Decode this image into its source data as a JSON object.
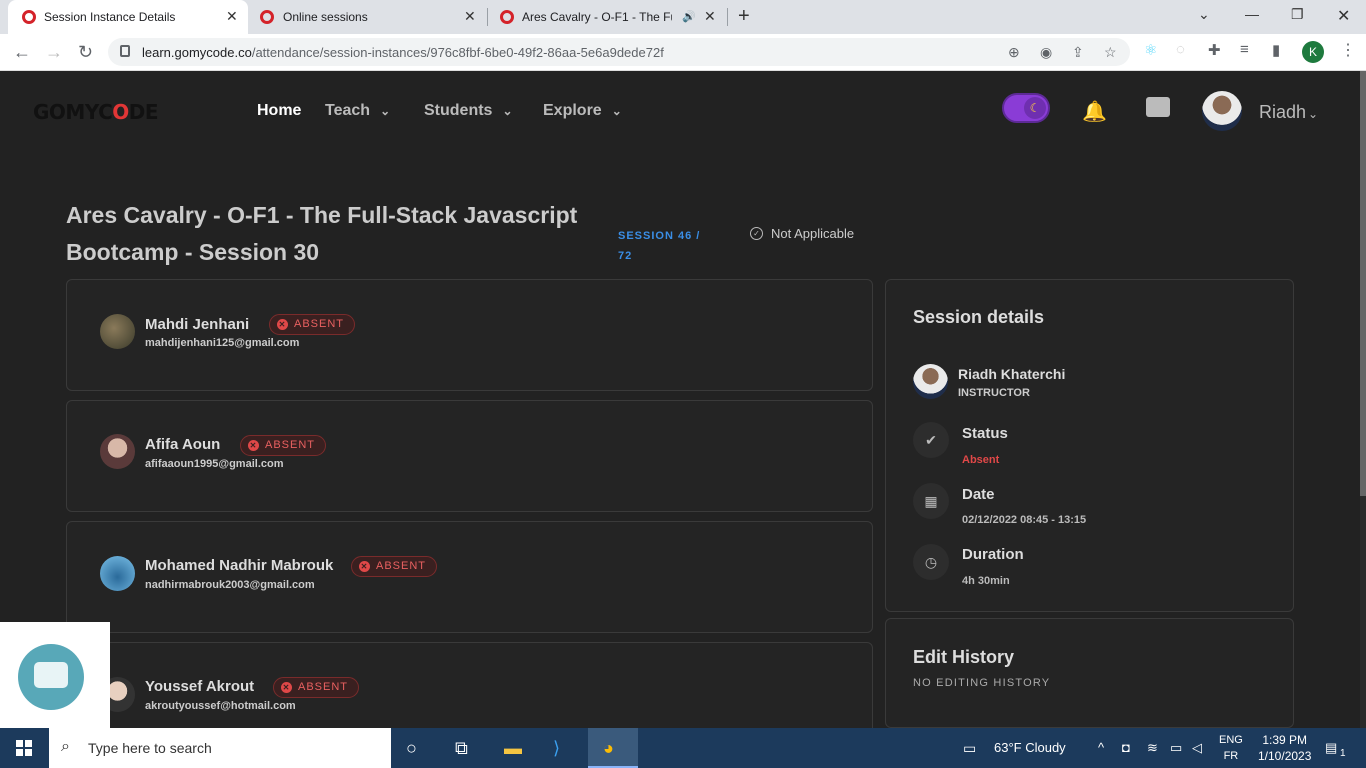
{
  "browser": {
    "tabs": [
      {
        "title": "Session Instance Details",
        "active": true
      },
      {
        "title": "Online sessions",
        "active": false
      },
      {
        "title": "Ares Cavalry - O-F1 - The Fu",
        "active": false
      }
    ],
    "url_host": "learn.gomycode.co",
    "url_path": "/attendance/session-instances/976c8fbf-6be0-49f2-86aa-5e6a9dede72f",
    "profile_initial": "K"
  },
  "app": {
    "logo_pre": "GOMYC",
    "logo_o": "O",
    "logo_post": "DE",
    "nav": [
      {
        "label": "Home"
      },
      {
        "label": "Teach"
      },
      {
        "label": "Students"
      },
      {
        "label": "Explore"
      }
    ],
    "user_name": "Riadh"
  },
  "session": {
    "title": "Ares Cavalry - O-F1 - The Full-Stack Javascript Bootcamp - Session 30",
    "session_number": "SESSION 46 / 72",
    "applicability": "Not Applicable"
  },
  "students": [
    {
      "name": "Mahdi Jenhani",
      "email": "mahdijenhani125@gmail.com",
      "status": "ABSENT"
    },
    {
      "name": "Afifa Aoun",
      "email": "afifaaoun1995@gmail.com",
      "status": "ABSENT"
    },
    {
      "name": "Mohamed Nadhir Mabrouk",
      "email": "nadhirmabrouk2003@gmail.com",
      "status": "ABSENT"
    },
    {
      "name": "Youssef Akrout",
      "email": "akroutyoussef@hotmail.com",
      "status": "ABSENT"
    }
  ],
  "details": {
    "title": "Session details",
    "instructor_name": "Riadh Khaterchi",
    "instructor_role": "INSTRUCTOR",
    "status_label": "Status",
    "status_value": "Absent",
    "date_label": "Date",
    "date_value": "02/12/2022 08:45 - 13:15",
    "duration_label": "Duration",
    "duration_value": "4h 30min"
  },
  "history": {
    "title": "Edit History",
    "empty": "NO EDITING HISTORY"
  },
  "taskbar": {
    "search_placeholder": "Type here to search",
    "weather": "63°F  Cloudy",
    "lang_top": "ENG",
    "lang_bottom": "FR",
    "time": "1:39 PM",
    "date": "1/10/2023",
    "notif_count": "1"
  },
  "colors": {
    "accent": "#3a8ee6",
    "absent": "#e04848",
    "toggle": "#8a3cd6",
    "background": "#222222"
  }
}
